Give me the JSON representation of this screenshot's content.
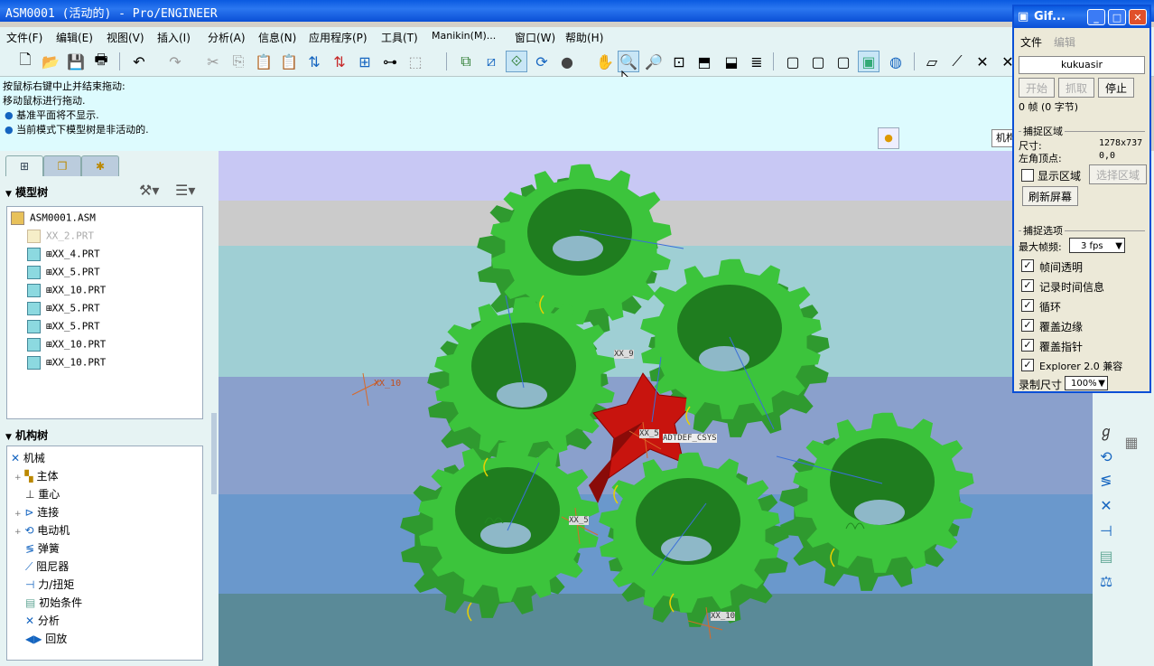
{
  "window": {
    "title": "ASM0001 (活动的) - Pro/ENGINEER"
  },
  "menu": [
    "文件(F)",
    "编辑(E)",
    "视图(V)",
    "插入(I)",
    "分析(A)",
    "信息(N)",
    "应用程序(P)",
    "工具(T)",
    "Manikin(M)...",
    "窗口(W)",
    "帮助(H)"
  ],
  "messages": [
    "按鼠标右键中止并结束拖动:",
    "移动鼠标进行拖动.",
    "基准平面将不显示.",
    "当前模式下模型树是非活动的."
  ],
  "model_tree": {
    "title": "模型树",
    "root": "ASM0001.ASM",
    "items": [
      "XX_2.PRT",
      "⊞XX_4.PRT",
      "⊞XX_5.PRT",
      "⊞XX_10.PRT",
      "⊞XX_5.PRT",
      "⊞XX_5.PRT",
      "⊞XX_10.PRT",
      "⊞XX_10.PRT"
    ]
  },
  "mech_tree": {
    "title": "机构树",
    "root": "机械",
    "items": [
      "主体",
      "重心",
      "连接",
      "电动机",
      "弹簧",
      "阻尼器",
      "力/扭矩",
      "初始条件",
      "分析",
      "回放"
    ]
  },
  "viewport": {
    "labels": [
      "XX_10",
      "XX_9",
      "XX_5",
      "ADTDEF_CSYS",
      "XX_5",
      "XX_10"
    ],
    "mode_tag": "机构"
  },
  "gif": {
    "title": "Gif...",
    "menu": [
      "文件",
      "编辑"
    ],
    "user": "kukuasir",
    "buttons": {
      "start": "开始",
      "grab": "抓取",
      "stop": "停止"
    },
    "frames": "0 帧 (0 字节)",
    "capture_area": "捕捉区域",
    "size_label": "尺寸:",
    "size_value": "1278x737",
    "corner_label": "左角顶点:",
    "corner_value": "0,0",
    "show_area": "显示区域",
    "select_area": "选择区域",
    "refresh": "刷新屏幕",
    "capture_options": "捕捉选项",
    "max_fps_label": "最大帧频:",
    "max_fps_value": "3 fps",
    "options": [
      "帧间透明",
      "记录时间信息",
      "循环",
      "覆盖边缘",
      "覆盖指针",
      "Explorer 2.0 兼容"
    ],
    "record_size_label": "录制尺寸",
    "record_size_value": "100%"
  }
}
